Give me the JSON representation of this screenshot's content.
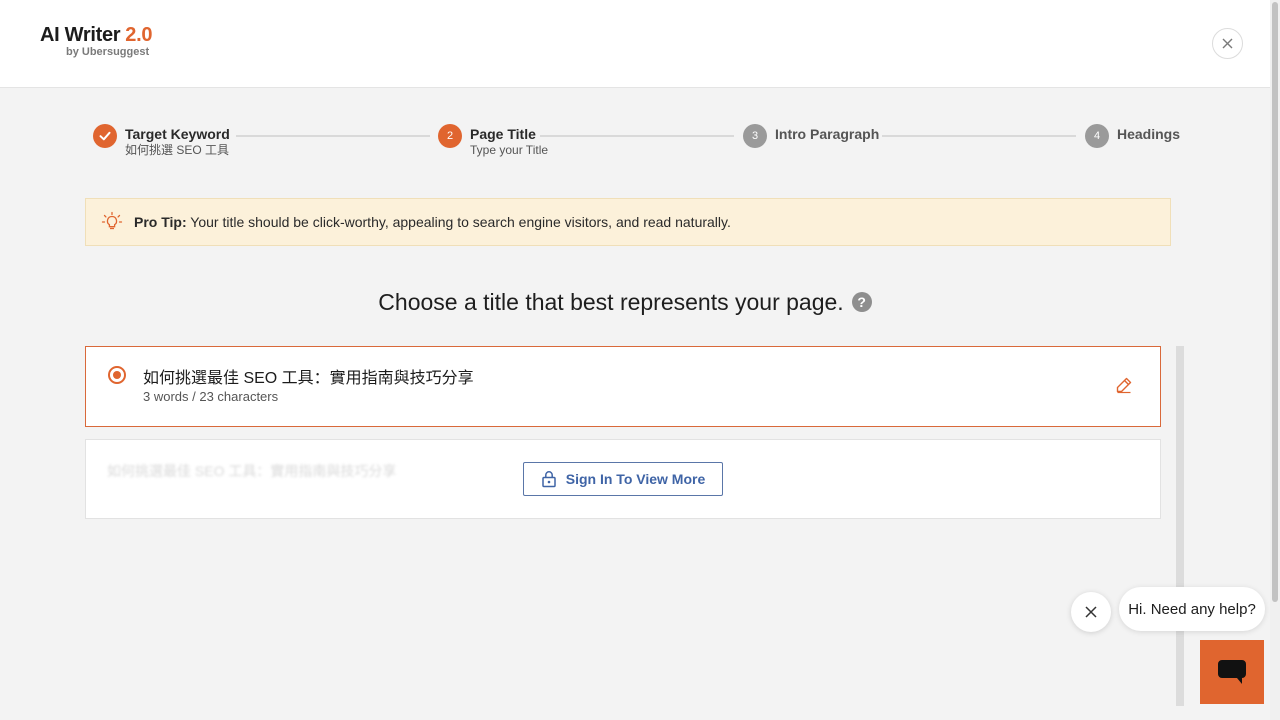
{
  "app": {
    "logo_title": "AI Writer",
    "logo_version": "2.0",
    "logo_sub": "by Ubersuggest"
  },
  "stepper": {
    "steps": [
      {
        "number": "1",
        "title": "Target Keyword",
        "subtitle": "如何挑選 SEO 工具",
        "state": "done"
      },
      {
        "number": "2",
        "title": "Page Title",
        "subtitle": "Type your Title",
        "state": "active"
      },
      {
        "number": "3",
        "title": "Intro Paragraph",
        "subtitle": "",
        "state": "upcoming"
      },
      {
        "number": "4",
        "title": "Headings",
        "subtitle": "",
        "state": "upcoming"
      }
    ]
  },
  "tip": {
    "label": "Pro Tip:",
    "text": " Your title should be click-worthy, appealing to search engine visitors, and read naturally."
  },
  "main": {
    "heading": "Choose a title that best represents your page.",
    "help_glyph": "?"
  },
  "titles": {
    "selected": {
      "text": "如何挑選最佳 SEO 工具：實用指南與技巧分享",
      "meta": "3 words / 23 characters"
    },
    "locked": {
      "blurred_text": "如何挑選最佳 SEO 工具：實用指南與技巧分享",
      "button_label": "Sign In To View More"
    }
  },
  "chat": {
    "bubble_text": "Hi. Need any help?"
  },
  "colors": {
    "accent": "#e0652f",
    "link_blue": "#3f64a6",
    "tip_bg": "#fcf1da",
    "upcoming_gray": "#9a9a9a"
  }
}
